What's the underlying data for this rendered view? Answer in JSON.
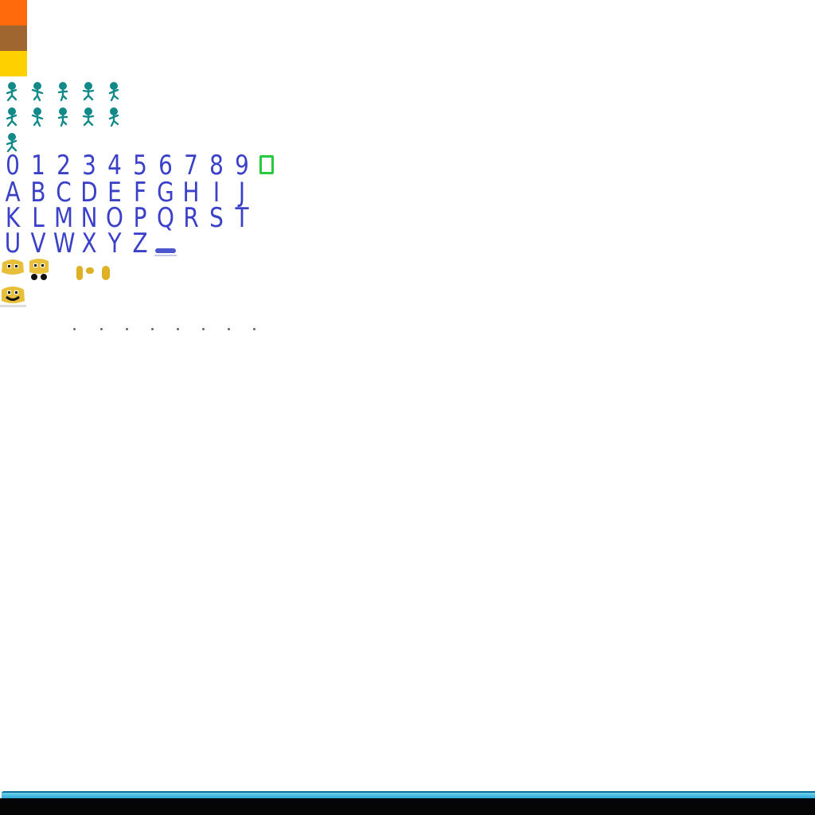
{
  "palette": {
    "swatches": [
      "#ff6a0c",
      "#a0662f",
      "#ffd000"
    ],
    "sprite_color": "#128a8a",
    "glyph_color": "#3a40c8",
    "highlight_glyph_color": "#27c93f",
    "face_color": "#e8bf3a",
    "floor_top_color": "#1aa0d6",
    "floor_bottom_color": "#050505"
  },
  "font_sheet": {
    "digits": [
      "0",
      "1",
      "2",
      "3",
      "4",
      "5",
      "6",
      "7",
      "8",
      "9"
    ],
    "row_a": [
      "A",
      "B",
      "C",
      "D",
      "E",
      "F",
      "G",
      "H",
      "I",
      "J"
    ],
    "row_k": [
      "K",
      "L",
      "M",
      "N",
      "O",
      "P",
      "Q",
      "R",
      "S",
      "T"
    ],
    "row_u": [
      "U",
      "V",
      "W",
      "X",
      "Y",
      "Z"
    ]
  },
  "sprites": {
    "character_frame_count": 11,
    "face_icons": [
      "player-face-icon",
      "player-face-walk-icon",
      "coin-pair-icon",
      "player-face-smile-icon"
    ]
  }
}
